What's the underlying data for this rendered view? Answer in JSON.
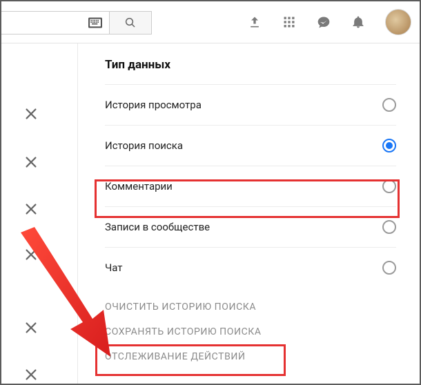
{
  "search": {
    "value": "",
    "placeholder": ""
  },
  "panel": {
    "title": "Тип данных",
    "options": [
      {
        "label": "История просмотра",
        "selected": false
      },
      {
        "label": "История поиска",
        "selected": true
      },
      {
        "label": "Комментарии",
        "selected": false
      },
      {
        "label": "Записи в сообществе",
        "selected": false
      },
      {
        "label": "Чат",
        "selected": false
      }
    ],
    "actions": [
      "Очистить историю поиска",
      "Сохранять историю поиска",
      "Отслеживание действий"
    ]
  }
}
